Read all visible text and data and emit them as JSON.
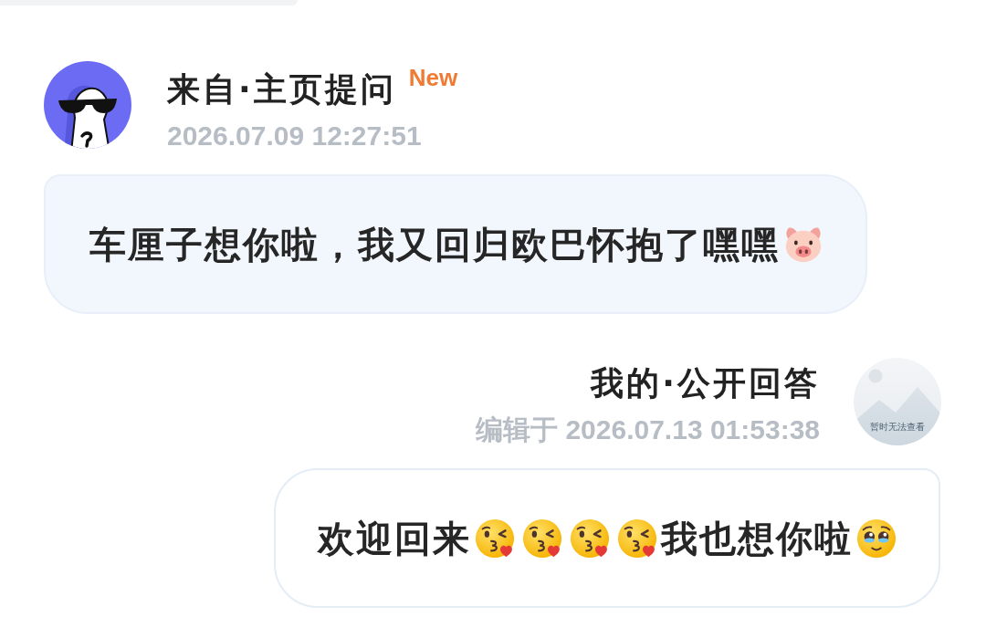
{
  "question": {
    "title": "来自·主页提问",
    "tag": "New",
    "time": "2026.07.09 12:27:51",
    "message": [
      {
        "kind": "text",
        "text": "车厘子想你啦，我又回归欧巴怀抱了嘿嘿"
      },
      {
        "kind": "pig"
      }
    ]
  },
  "answer": {
    "title": "我的·公开回答",
    "time": "编辑于 2026.07.13 01:53:38",
    "avatar_text": "暂时无法查看",
    "message": [
      {
        "kind": "text",
        "text": "欢迎回来"
      },
      {
        "kind": "kiss"
      },
      {
        "kind": "kiss"
      },
      {
        "kind": "kiss"
      },
      {
        "kind": "kiss"
      },
      {
        "kind": "text",
        "text": "我也想你啦"
      },
      {
        "kind": "teary"
      }
    ]
  }
}
